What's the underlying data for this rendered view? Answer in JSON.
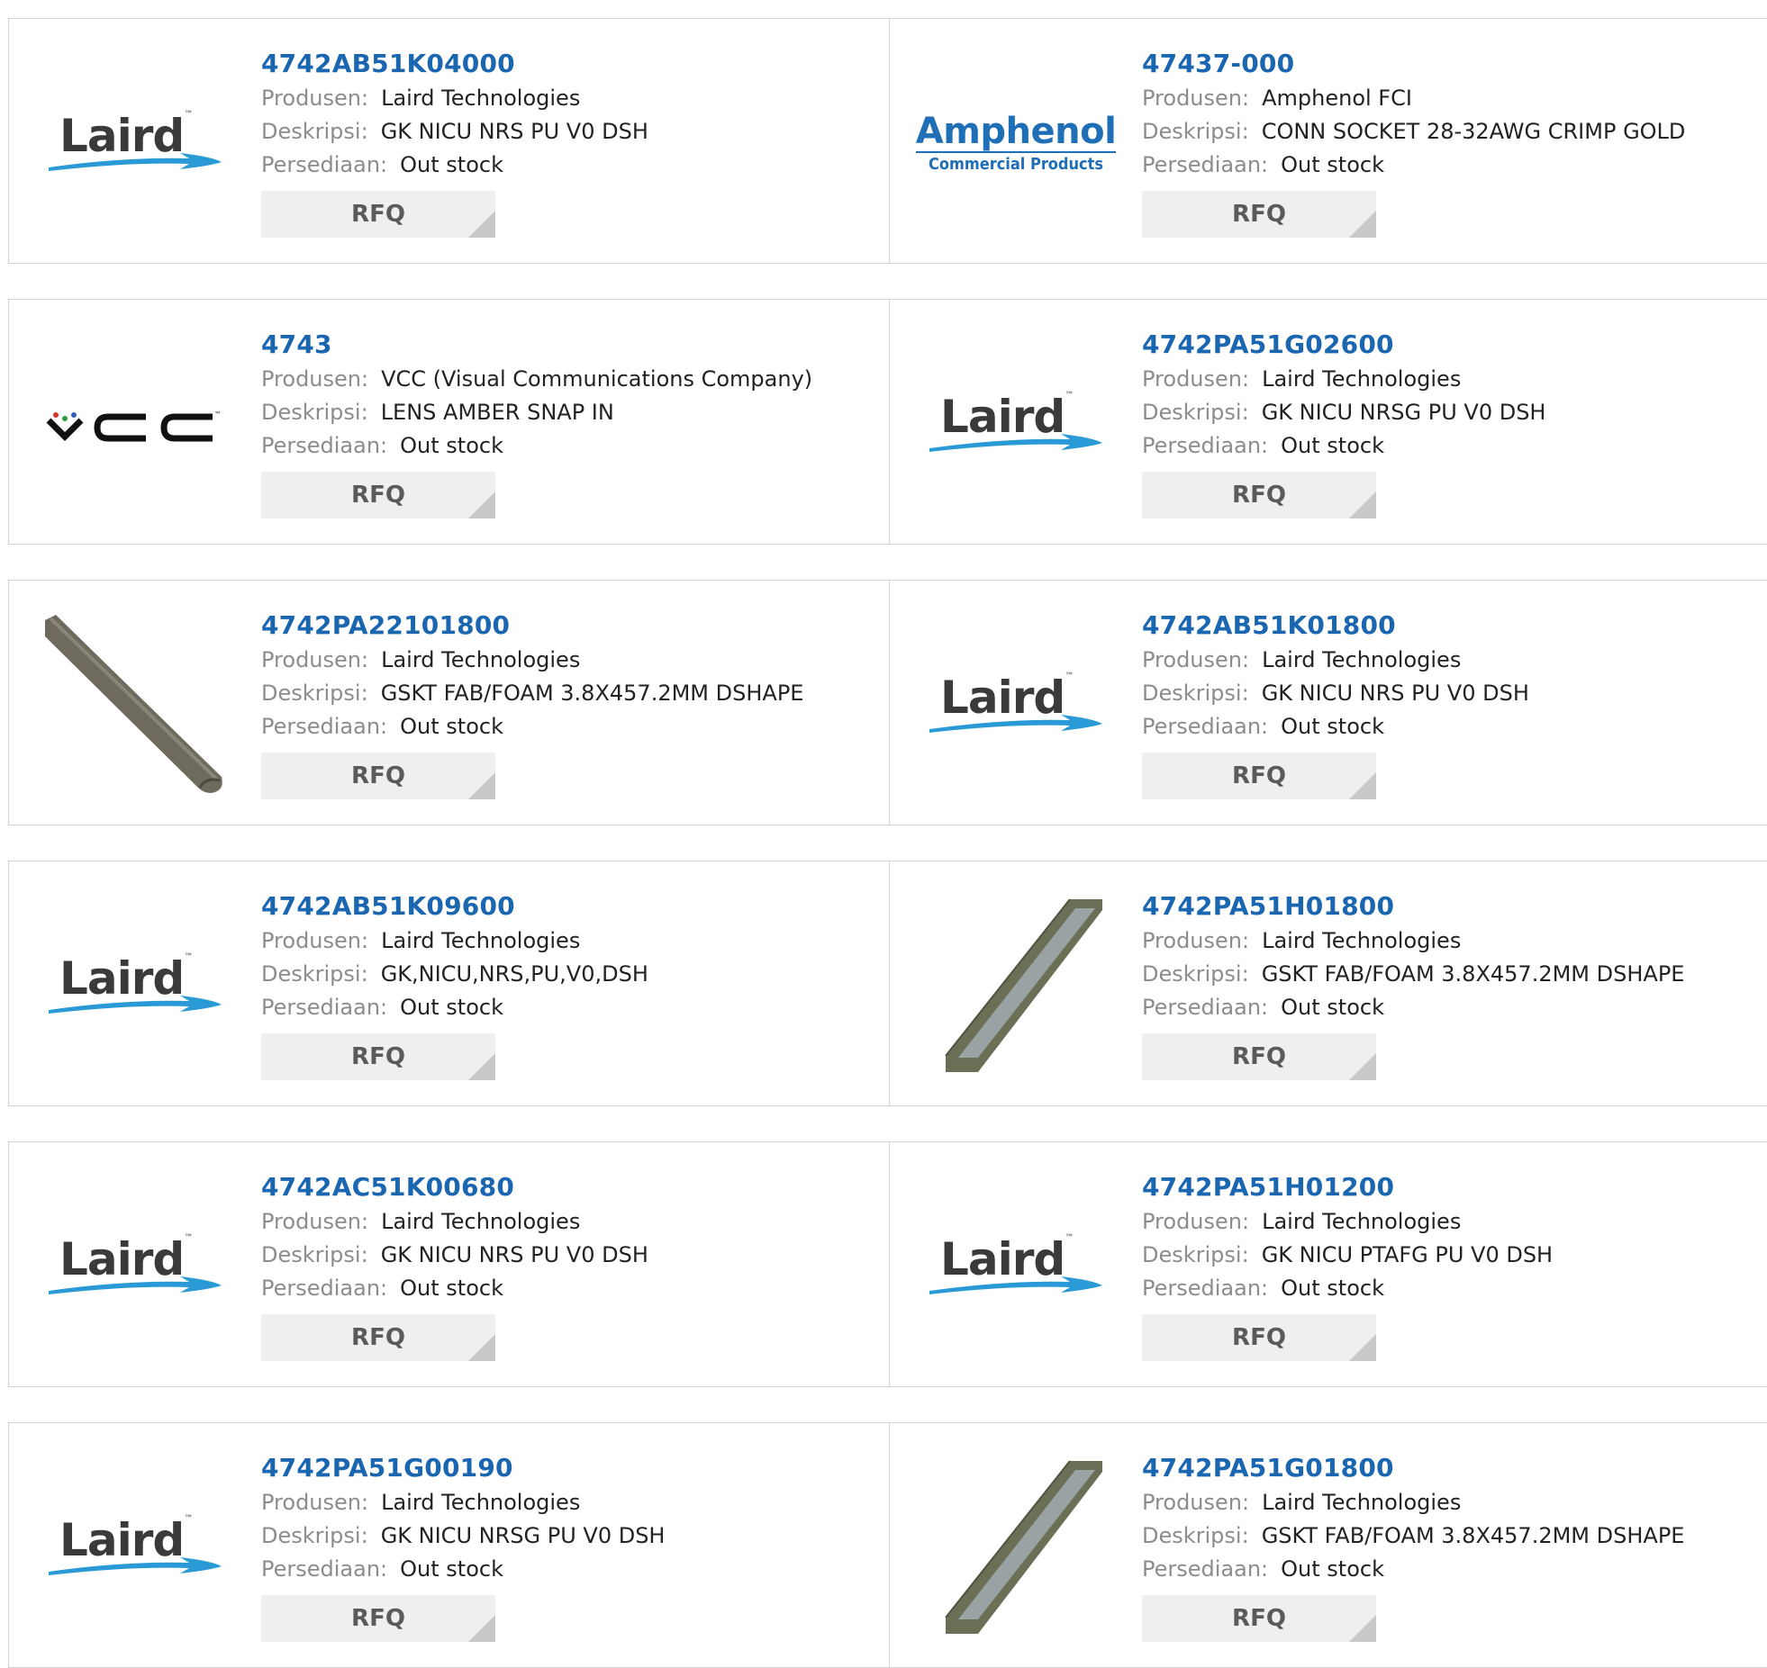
{
  "labels": {
    "manufacturer": "Produsen:",
    "description": "Deskripsi:",
    "stock": "Persediaan:",
    "rfq": "RFQ"
  },
  "products": [
    {
      "part": "4742AB51K04000",
      "manufacturer": "Laird Technologies",
      "description": "GK NICU NRS PU V0 DSH",
      "stock": "Out stock",
      "image": "laird-logo"
    },
    {
      "part": "47437-000",
      "manufacturer": "Amphenol FCI",
      "description": "CONN SOCKET 28-32AWG CRIMP GOLD",
      "stock": "Out stock",
      "image": "amphenol-logo",
      "logo_text": [
        "Amphenol",
        "Commercial Products"
      ]
    },
    {
      "part": "4743",
      "manufacturer": "VCC (Visual Communications Company)",
      "description": "LENS AMBER SNAP IN",
      "stock": "Out stock",
      "image": "vcc-logo"
    },
    {
      "part": "4742PA51G02600",
      "manufacturer": "Laird Technologies",
      "description": "GK NICU NRSG PU V0 DSH",
      "stock": "Out stock",
      "image": "laird-logo"
    },
    {
      "part": "4742PA22101800",
      "manufacturer": "Laird Technologies",
      "description": "GSKT FAB/FOAM 3.8X457.2MM DSHAPE",
      "stock": "Out stock",
      "image": "gasket-dark-photo"
    },
    {
      "part": "4742AB51K01800",
      "manufacturer": "Laird Technologies",
      "description": "GK NICU NRS PU V0 DSH",
      "stock": "Out stock",
      "image": "laird-logo"
    },
    {
      "part": "4742AB51K09600",
      "manufacturer": "Laird Technologies",
      "description": "GK,NICU,NRS,PU,V0,DSH",
      "stock": "Out stock",
      "image": "laird-logo"
    },
    {
      "part": "4742PA51H01800",
      "manufacturer": "Laird Technologies",
      "description": "GSKT FAB/FOAM 3.8X457.2MM DSHAPE",
      "stock": "Out stock",
      "image": "gasket-strip-photo"
    },
    {
      "part": "4742AC51K00680",
      "manufacturer": "Laird Technologies",
      "description": "GK NICU NRS PU V0 DSH",
      "stock": "Out stock",
      "image": "laird-logo"
    },
    {
      "part": "4742PA51H01200",
      "manufacturer": "Laird Technologies",
      "description": "GK NICU PTAFG PU V0 DSH",
      "stock": "Out stock",
      "image": "laird-logo"
    },
    {
      "part": "4742PA51G00190",
      "manufacturer": "Laird Technologies",
      "description": "GK NICU NRSG PU V0 DSH",
      "stock": "Out stock",
      "image": "laird-logo"
    },
    {
      "part": "4742PA51G01800",
      "manufacturer": "Laird Technologies",
      "description": "GSKT FAB/FOAM 3.8X457.2MM DSHAPE",
      "stock": "Out stock",
      "image": "gasket-strip-photo"
    }
  ],
  "colors": {
    "part_link": "#1a66b0",
    "label": "#8c8c8c",
    "value": "#222222",
    "border": "#d2d2d2",
    "rfq_bg": "#efefef",
    "laird_swoosh": "#2a9ad6"
  }
}
